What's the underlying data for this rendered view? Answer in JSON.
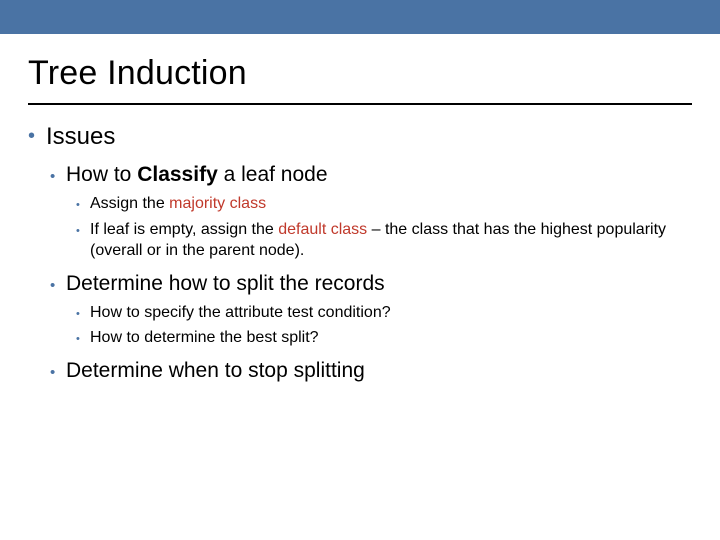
{
  "title": "Tree Induction",
  "lvl1": {
    "item0": "Issues"
  },
  "lvl2": {
    "item0_pre": "How to ",
    "item0_bold": "Classify",
    "item0_post": " a leaf node",
    "item1": "Determine how to split the records",
    "item2": "Determine when to stop splitting"
  },
  "lvl3": {
    "a0_pre": "Assign the ",
    "a0_red": "majority class",
    "a1_pre": "If leaf is empty, assign the ",
    "a1_red": "default class",
    "a1_post": " – the class that has the highest popularity (overall or in the parent node).",
    "b0": "How to specify the attribute test condition?",
    "b1": "How to determine the best split?"
  },
  "bullet": "•"
}
